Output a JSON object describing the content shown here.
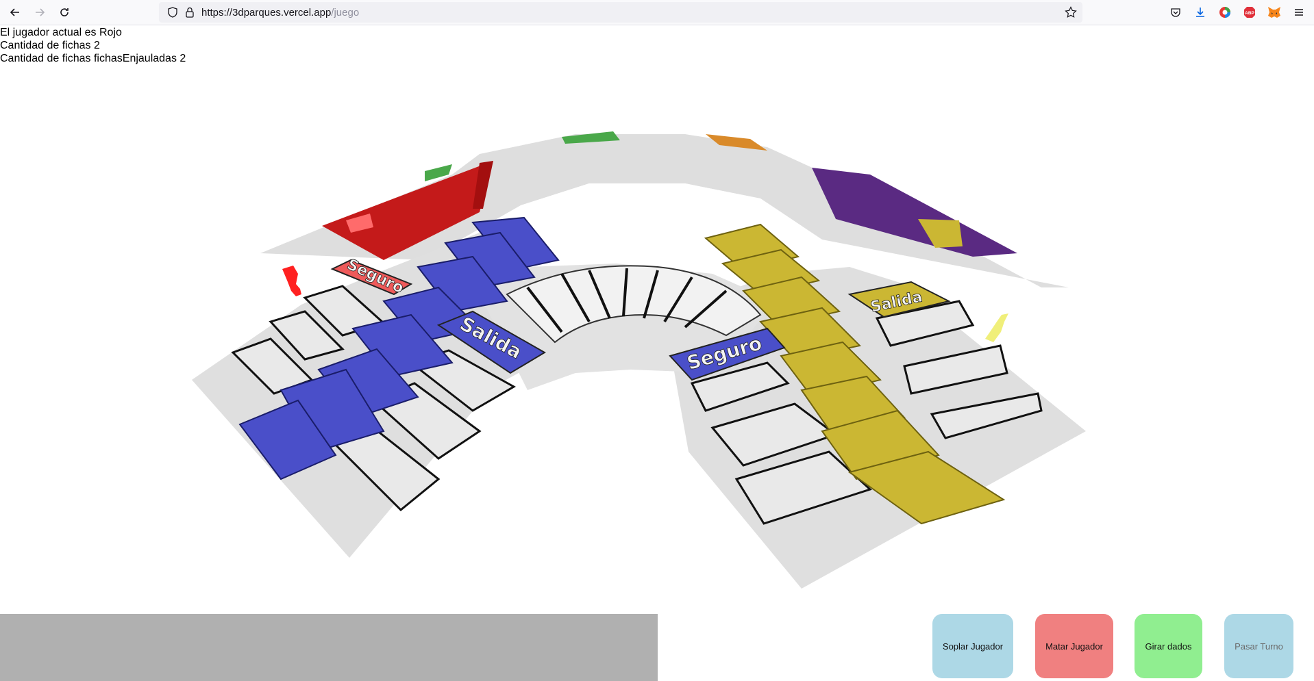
{
  "browser": {
    "url_host": "https://3dparques.vercel.app",
    "url_path": "/juego",
    "icons": [
      "back-arrow-icon",
      "forward-arrow-icon",
      "reload-icon",
      "shield-icon",
      "lock-icon",
      "bookmark-star-icon",
      "pocket-icon",
      "download-icon",
      "color-extension-icon",
      "adblock-icon",
      "metamask-fox-icon",
      "menu-icon"
    ],
    "adblock_text": "ABP"
  },
  "game_info": {
    "current_player": "El jugador actual es Rojo",
    "pieces_count": "Cantidad de fichas 2",
    "jailed_count": "Cantidad de fichas fichasEnjauladas 2"
  },
  "board": {
    "labels": {
      "seguro_red": "Seguro",
      "salida_blue": "Salida",
      "seguro_blue": "Seguro",
      "salida_yellow": "Salida"
    },
    "colors": {
      "red": "#c41a1a",
      "blue": "#4a4fc9",
      "yellow": "#cbb733",
      "purple": "#5a2a82",
      "green": "#4aa84a",
      "orange": "#d98a2a",
      "board": "#e0e0e0",
      "piece_red": "#ff2020",
      "piece_yellow": "#f0ef7a"
    }
  },
  "actions": {
    "soplar": {
      "label": "Soplar Jugador",
      "color": "#add8e6"
    },
    "matar": {
      "label": "Matar Jugador",
      "color": "#f08080"
    },
    "girar": {
      "label": "Girar dados",
      "color": "#90ee90"
    },
    "pasar": {
      "label": "Pasar Turno",
      "color": "#add8e6"
    }
  }
}
